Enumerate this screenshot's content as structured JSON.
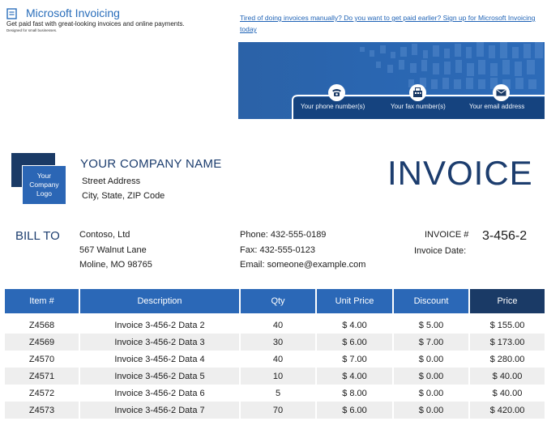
{
  "branding": {
    "product_name": "Microsoft Invoicing",
    "tagline": "Get paid fast with great-looking invoices and online payments.",
    "small_print": "Designed for small businesses."
  },
  "promo": {
    "link_text": "Tired of doing invoices manually? Do you want to get paid earlier? Sign up for Microsoft Invoicing today"
  },
  "banner": {
    "contacts": [
      {
        "icon": "phone-icon",
        "label": "Your phone number(s)"
      },
      {
        "icon": "fax-icon",
        "label": "Your fax number(s)"
      },
      {
        "icon": "email-icon",
        "label": "Your email address"
      }
    ]
  },
  "company": {
    "logo_text": "Your Company Logo",
    "name": "YOUR COMPANY NAME",
    "street": "Street Address",
    "city_state_zip": "City, State, ZIP Code"
  },
  "document_title": "INVOICE",
  "bill_to": {
    "label": "BILL TO",
    "name": "Contoso, Ltd",
    "street": "567 Walnut Lane",
    "city": "Moline, MO 98765",
    "phone": "Phone: 432-555-0189",
    "fax": "Fax: 432-555-0123",
    "email": "Email: someone@example.com"
  },
  "invoice_meta": {
    "number_label": "INVOICE #",
    "number_value": "3-456-2",
    "date_label": "Invoice Date:"
  },
  "table": {
    "headers": [
      "Item #",
      "Description",
      "Qty",
      "Unit Price",
      "Discount",
      "Price"
    ],
    "rows": [
      [
        "Z4568",
        "Invoice 3-456-2 Data 2",
        "40",
        "$ 4.00",
        "$ 5.00",
        "$ 155.00"
      ],
      [
        "Z4569",
        "Invoice 3-456-2 Data 3",
        "30",
        "$ 6.00",
        "$ 7.00",
        "$ 173.00"
      ],
      [
        "Z4570",
        "Invoice 3-456-2 Data 4",
        "40",
        "$ 7.00",
        "$ 0.00",
        "$ 280.00"
      ],
      [
        "Z4571",
        "Invoice 3-456-2 Data 5",
        "10",
        "$ 4.00",
        "$ 0.00",
        "$ 40.00"
      ],
      [
        "Z4572",
        "Invoice 3-456-2 Data 6",
        "5",
        "$ 8.00",
        "$ 0.00",
        "$ 40.00"
      ],
      [
        "Z4573",
        "Invoice 3-456-2 Data 7",
        "70",
        "$ 6.00",
        "$ 0.00",
        "$ 420.00"
      ]
    ]
  },
  "colors": {
    "brand_blue": "#2b68b7",
    "navy": "#1a3a66",
    "link_blue": "#1f63b6",
    "row_shade": "#eeeeee"
  }
}
